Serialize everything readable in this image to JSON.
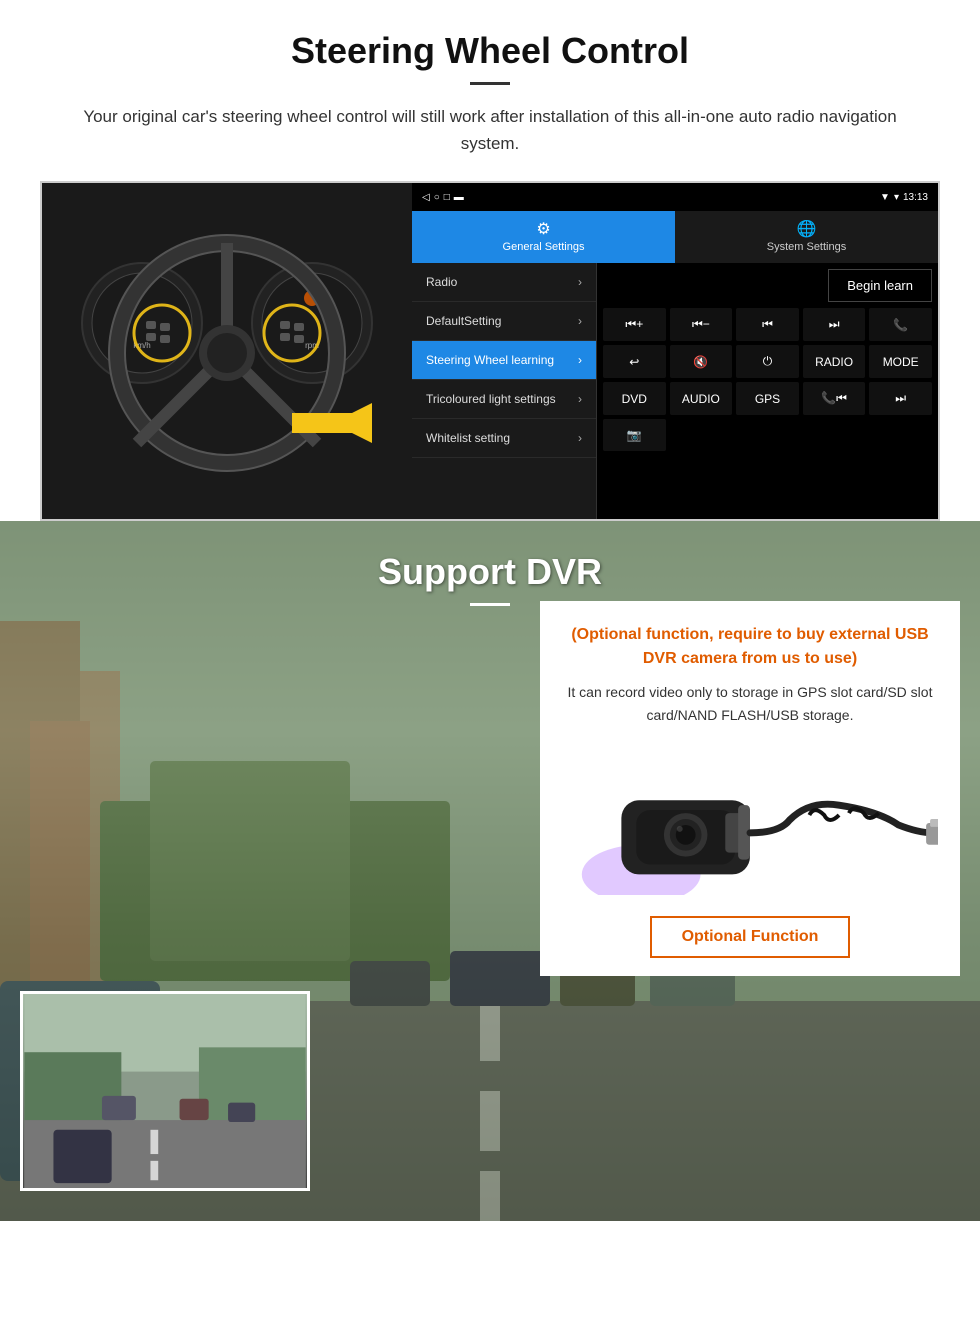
{
  "steering": {
    "title": "Steering Wheel Control",
    "description": "Your original car's steering wheel control will still work after installation of this all-in-one auto radio navigation system.",
    "statusbar": {
      "time": "13:13",
      "signal_icon": "▼",
      "wifi_icon": "▾",
      "battery_icon": "▮"
    },
    "tabs": [
      {
        "label": "General Settings",
        "icon": "⚙",
        "active": true
      },
      {
        "label": "System Settings",
        "icon": "🌐",
        "active": false
      }
    ],
    "menu_items": [
      {
        "label": "Radio",
        "active": false
      },
      {
        "label": "DefaultSetting",
        "active": false
      },
      {
        "label": "Steering Wheel learning",
        "active": true
      },
      {
        "label": "Tricoloured light settings",
        "active": false
      },
      {
        "label": "Whitelist setting",
        "active": false
      }
    ],
    "begin_learn_label": "Begin learn",
    "control_buttons": [
      "⏮+",
      "⏮-",
      "⏮",
      "⏭",
      "📞",
      "↩",
      "🔇",
      "⏻",
      "RADIO",
      "MODE",
      "DVD",
      "AUDIO",
      "GPS",
      "📞⏮",
      "⏭"
    ]
  },
  "dvr": {
    "title": "Support DVR",
    "optional_title": "(Optional function, require to buy external USB DVR camera from us to use)",
    "description": "It can record video only to storage in GPS slot card/SD slot card/NAND FLASH/USB storage.",
    "optional_function_label": "Optional Function"
  }
}
